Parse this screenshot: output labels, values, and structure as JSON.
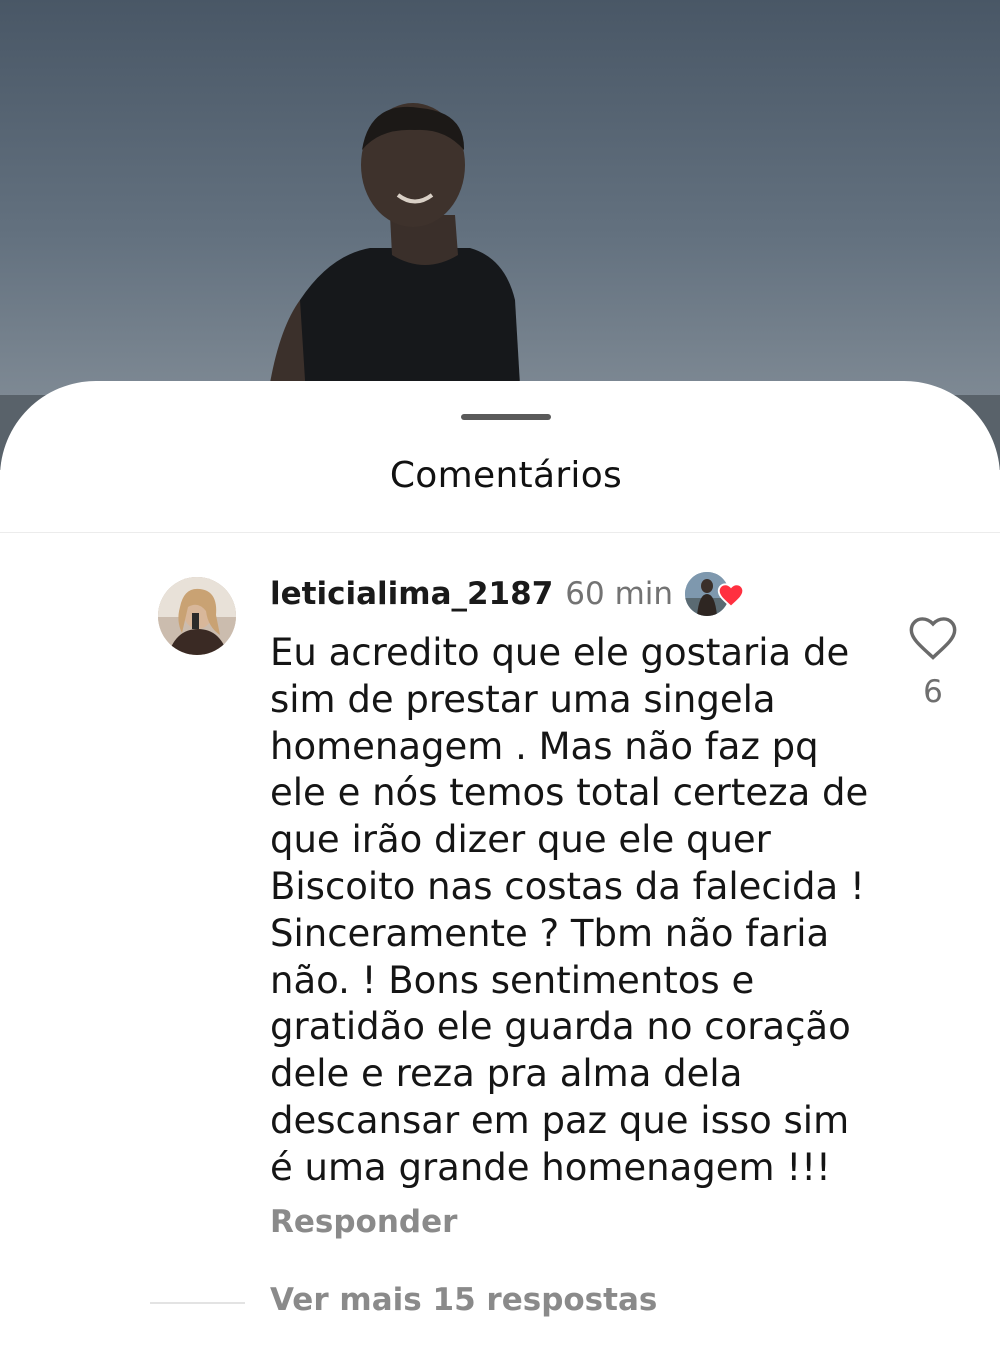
{
  "background_photo": {
    "description_icon": "person-silhouette-photo"
  },
  "sheet": {
    "title": "Comentários"
  },
  "comment": {
    "username": "leticialima_2187",
    "timestamp": "60 min",
    "text": "Eu acredito que ele gostaria de\nsim de prestar uma singela\nhomenagem . Mas não faz pq\nele e nós temos total certeza de\nque irão dizer que ele quer\nBiscoito nas costas da falecida !\nSinceramente ? Tbm não faria\nnão. ! Bons sentimentos e\ngratidão ele guarda no coração\ndele e reza pra alma dela\ndescansar em paz que isso sim\né uma grande homenagem !!!",
    "reply_label": "Responder",
    "like_count": "6",
    "creator_liked": true,
    "view_replies_label": "Ver mais 15 respostas"
  },
  "colors": {
    "heart_red": "#ff3040",
    "secondary_text": "#737373",
    "primary_text": "#151515"
  }
}
